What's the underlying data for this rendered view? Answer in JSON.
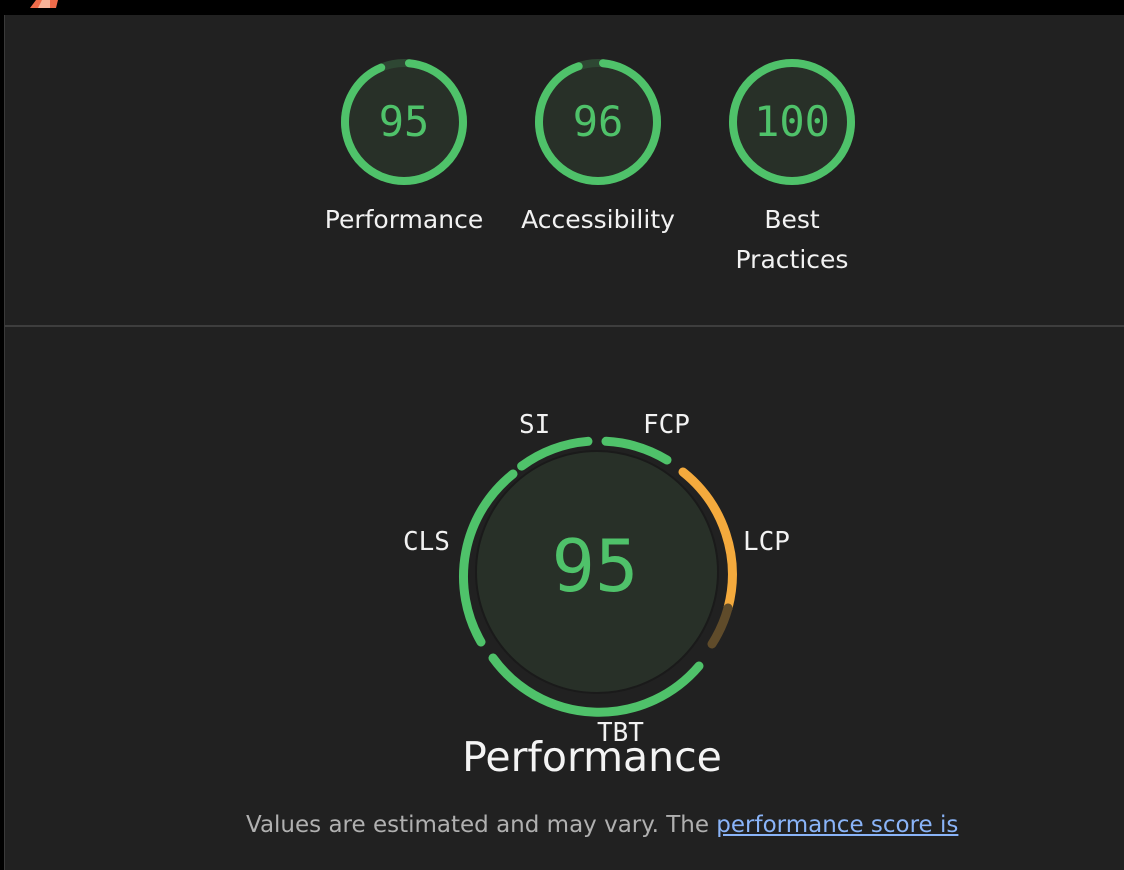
{
  "colors": {
    "pass": "#4fc26a",
    "average": "#f4aa3d",
    "average_dim": "#5f4b2a",
    "gauge_fill": "#283028",
    "text": "#f2f2f2",
    "muted": "#b0b0b0",
    "link": "#8ab4f8"
  },
  "icons": {
    "logo": "lighthouse-logo-icon"
  },
  "scores": [
    {
      "value": "95",
      "label": "Performance",
      "score": 0.95
    },
    {
      "value": "96",
      "label": "Accessibility",
      "score": 0.96
    },
    {
      "value": "100",
      "label": "Best Practices",
      "score": 1.0
    }
  ],
  "performance_gauge": {
    "score": "95",
    "title": "Performance",
    "metrics": {
      "si": "SI",
      "fcp": "FCP",
      "lcp": "LCP",
      "tbt": "TBT",
      "cls": "CLS"
    }
  },
  "footnote": {
    "text": "Values are estimated and may vary. The ",
    "link": "performance score is"
  }
}
